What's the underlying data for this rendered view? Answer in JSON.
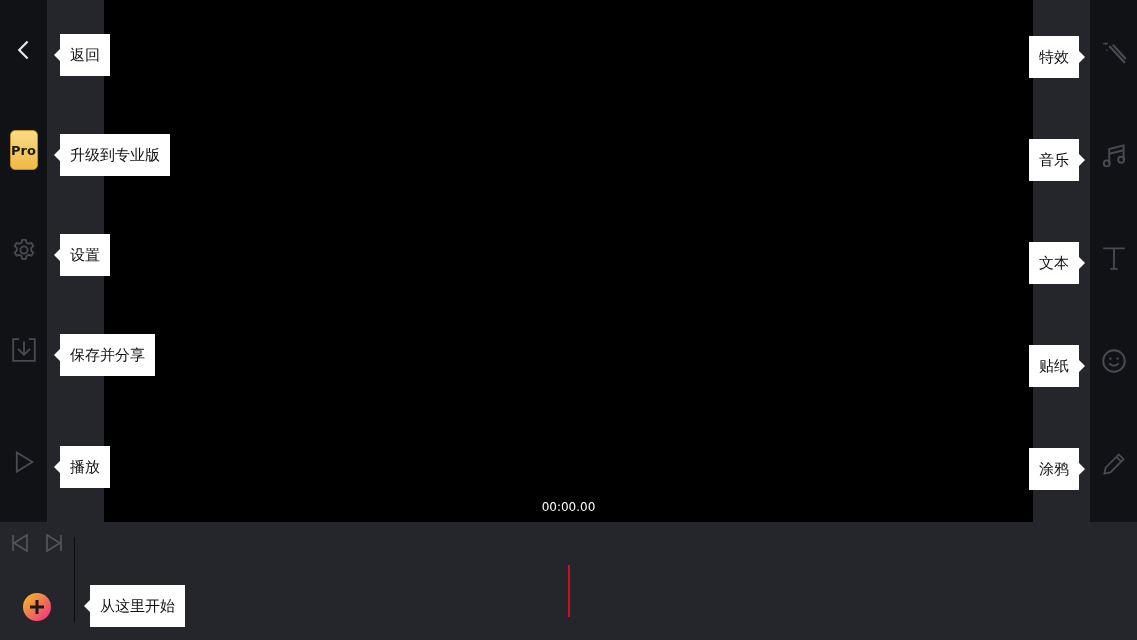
{
  "left_toolbar": {
    "items": [
      {
        "kind": "back",
        "tooltip": "返回"
      },
      {
        "kind": "pro",
        "label": "Pro",
        "tooltip": "升级到专业版"
      },
      {
        "kind": "settings",
        "tooltip": "设置"
      },
      {
        "kind": "save",
        "tooltip": "保存并分享"
      },
      {
        "kind": "play",
        "tooltip": "播放"
      }
    ]
  },
  "preview": {
    "timecode": "00:00.00"
  },
  "right_toolbar": {
    "items": [
      {
        "kind": "effects",
        "tooltip": "特效"
      },
      {
        "kind": "music",
        "tooltip": "音乐"
      },
      {
        "kind": "text",
        "tooltip": "文本"
      },
      {
        "kind": "sticker",
        "tooltip": "贴纸"
      },
      {
        "kind": "draw",
        "tooltip": "涂鸦"
      }
    ]
  },
  "timeline": {
    "add_tooltip": "从这里开始"
  }
}
